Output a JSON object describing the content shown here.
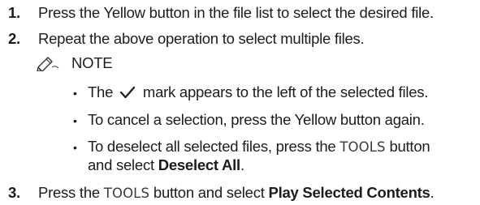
{
  "steps": [
    {
      "num": "1.",
      "text": "Press the Yellow button in the file list to select the desired file."
    },
    {
      "num": "2.",
      "text": "Repeat the above operation to select multiple files."
    },
    {
      "num": "3.",
      "pre": "Press the ",
      "tools": "TOOLS",
      "mid": " button and select ",
      "bold": "Play Selected Contents",
      "post": "."
    }
  ],
  "note": {
    "label": "NOTE",
    "icon": "pencil-note-icon",
    "bullets": [
      {
        "pre": "The ",
        "icon": "checkmark-icon",
        "post": " mark appears to the left of the selected files."
      },
      {
        "text": "To cancel a selection, press the Yellow button again."
      },
      {
        "pre": "To deselect all selected files, press the ",
        "tools": "TOOLS",
        "post": " button",
        "line2_pre": "and select ",
        "line2_bold": "Deselect All",
        "line2_post": "."
      }
    ]
  }
}
